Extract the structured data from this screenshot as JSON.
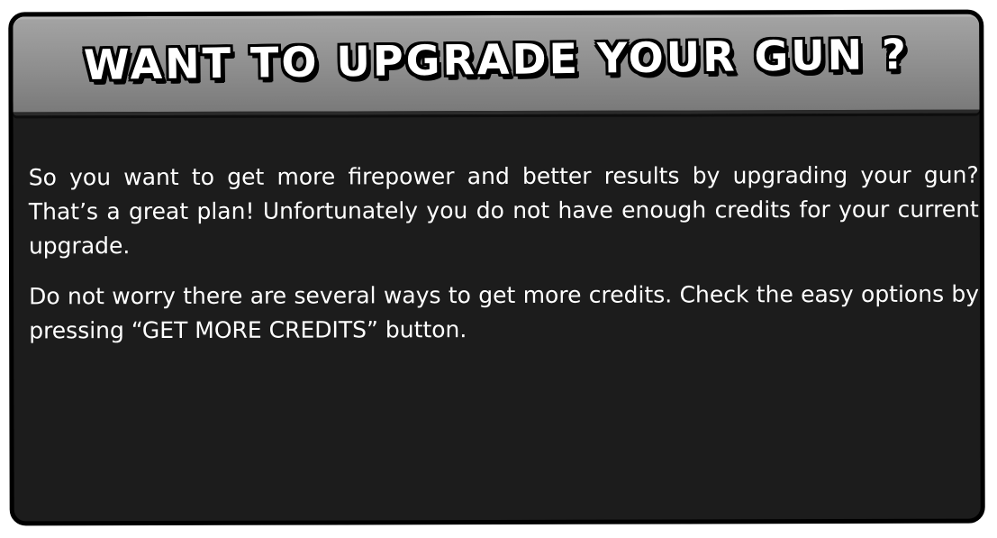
{
  "dialog": {
    "title": "WANT TO UPGRADE YOUR GUN ?",
    "paragraphs": [
      "So you want to get more firepower and better results by upgrading your gun? That’s a great plan! Unfortunately you do not have enough credits for your current upgrade.",
      "Do not worry there are several ways to get more credits. Check the easy options by pressing “GET MORE CREDITS” button."
    ]
  },
  "colors": {
    "panel_background": "#1c1c1c",
    "header_background": "#8e8e8e",
    "border": "#000000",
    "text": "#ffffff"
  }
}
